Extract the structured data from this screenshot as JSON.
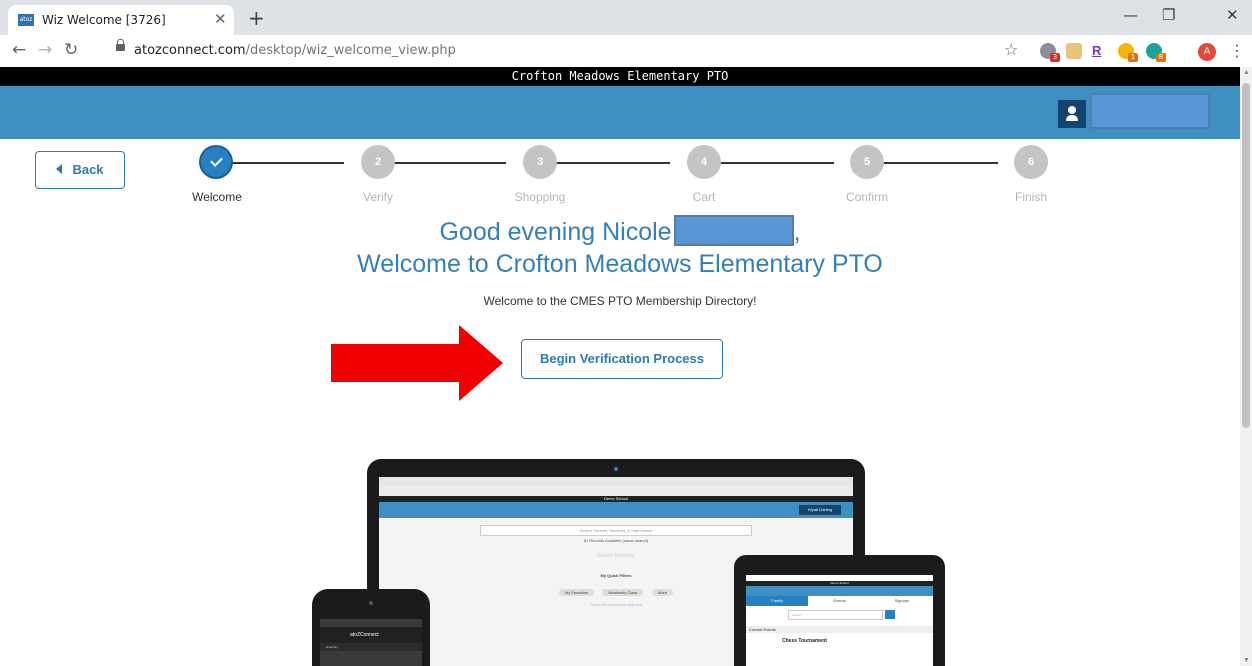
{
  "browser": {
    "tab_title": "Wiz Welcome [3726]",
    "tab_favicon_text": "atoz",
    "url_domain": "atozconnect.com",
    "url_path": "/desktop/wiz_welcome_view.php",
    "extension_badges": [
      "3",
      "1",
      "8"
    ],
    "profile_initial": "A"
  },
  "page": {
    "org_title": "Crofton Meadows Elementary PTO",
    "back_label": "Back",
    "wizard_steps": [
      {
        "num": "",
        "label": "Welcome",
        "state": "done"
      },
      {
        "num": "2",
        "label": "Verify",
        "state": "pending"
      },
      {
        "num": "3",
        "label": "Shopping",
        "state": "pending"
      },
      {
        "num": "4",
        "label": "Cart",
        "state": "pending"
      },
      {
        "num": "5",
        "label": "Confirm",
        "state": "pending"
      },
      {
        "num": "6",
        "label": "Finish",
        "state": "pending"
      }
    ],
    "greeting_prefix": "Good evening Nicole",
    "greeting_suffix": ",",
    "welcome_heading": "Welcome to Crofton Meadows Elementary PTO",
    "welcome_text": "Welcome to the CMES PTO Membership Directory!",
    "begin_button": "Begin Verification Process"
  },
  "mockups": {
    "laptop": {
      "title": "Demo School",
      "user_button": "Wyatt Darling",
      "search_placeholder": "Search Parents, Students, & Staff names",
      "records": "81 Records Available (name search)",
      "hint": "Search Directory",
      "filters_title": "My Quick Filters",
      "chips": [
        "My Favorites",
        "Weatherly Class",
        "More"
      ],
      "link": "Demo School Admin Approve"
    },
    "tablet": {
      "title": "Demo School",
      "tabs": [
        "Family",
        "Events",
        "Signups"
      ],
      "search_placeholder": "search",
      "current_events": "Current Events",
      "event_title": "Chess Tournament"
    },
    "phone": {
      "brand": "atoZConnect",
      "menu_item": "Directory"
    }
  },
  "colors": {
    "header_blue": "#3f8fc3",
    "accent_blue": "#2d7ab4",
    "arrow_red": "#f00000"
  }
}
